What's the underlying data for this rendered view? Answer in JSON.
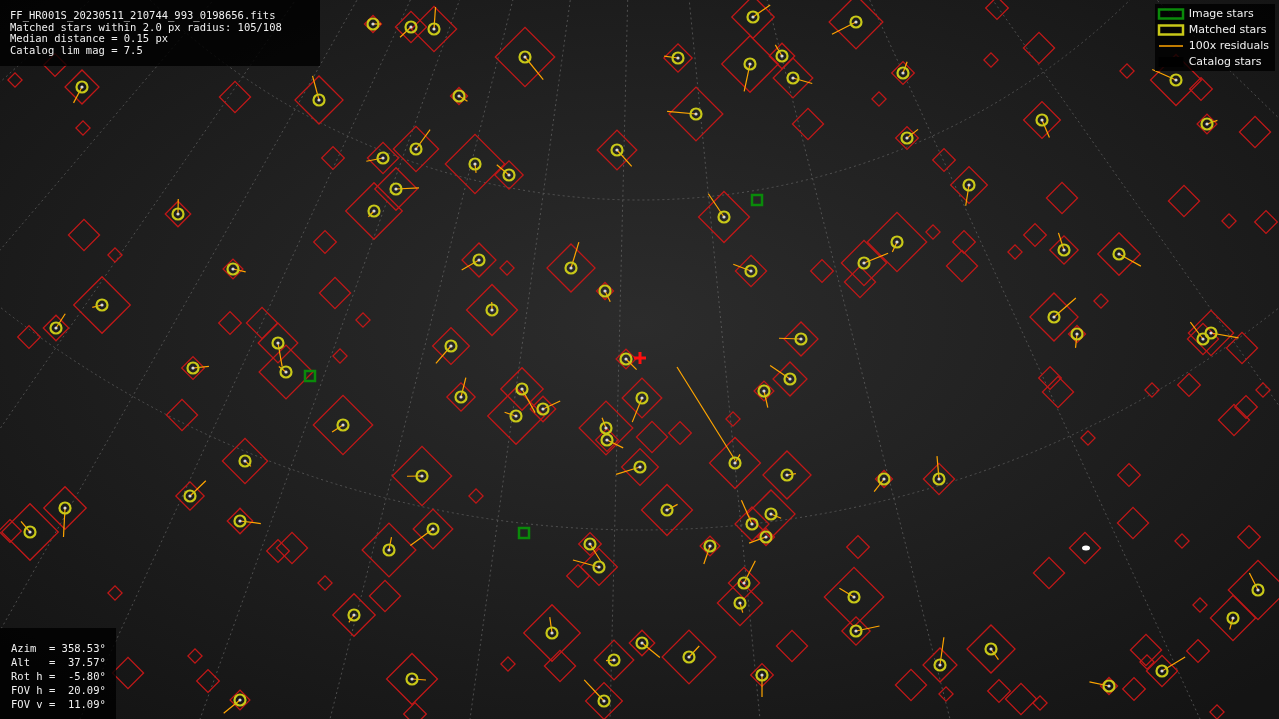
{
  "info_panel": {
    "lines": [
      "FF_HR001S_20230511_210744_993_0198656.fits",
      "Matched stars within 2.0 px radius: 105/108",
      "Median distance = 0.15 px",
      "Catalog lim mag = 7.5"
    ]
  },
  "legend": [
    {
      "kind": "image",
      "label": "Image stars"
    },
    {
      "kind": "matched",
      "label": "Matched stars"
    },
    {
      "kind": "residual",
      "label": "100x residuals"
    },
    {
      "kind": "catalog",
      "label": "Catalog stars"
    }
  ],
  "pointing_panel": {
    "lines": [
      "Azim  = 358.53°",
      "Alt   =  37.57°",
      "Rot h =  -5.80°",
      "FOV h =  20.09°",
      "FOV v =  11.09°"
    ]
  }
}
